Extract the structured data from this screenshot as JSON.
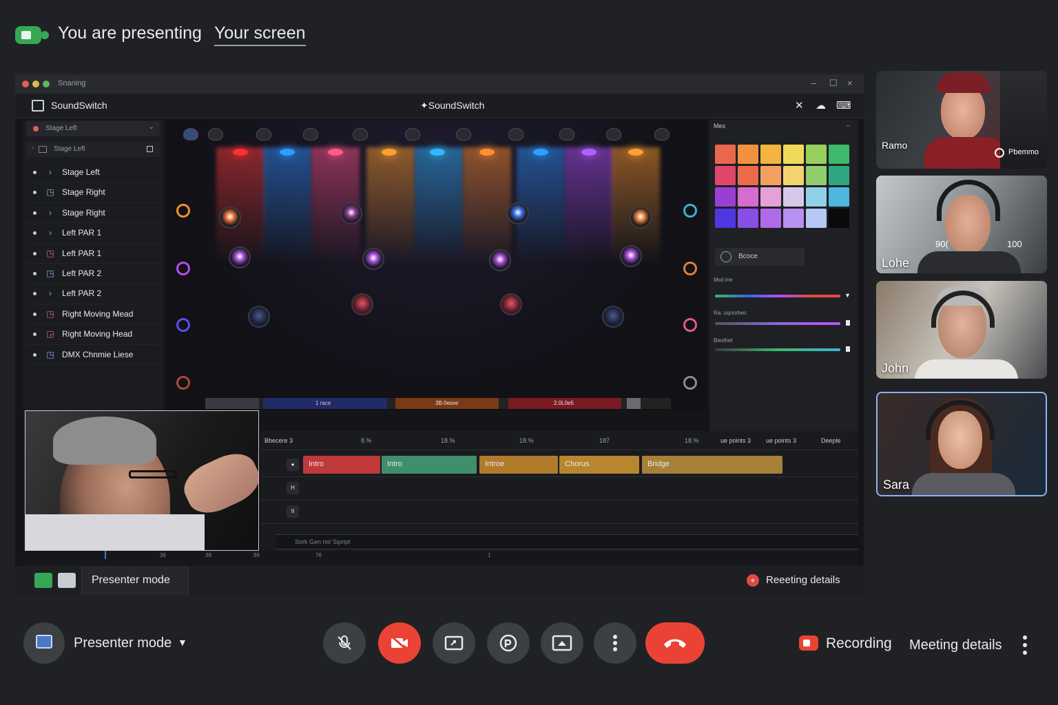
{
  "topbar": {
    "presenting_text": "You are presenting",
    "presenting_link": "Your screen"
  },
  "shared_window": {
    "title": "Snaning",
    "app_name": "SoundSwitch",
    "app_center_title": "✦SoundSwitch",
    "stage_select": "Stage Left",
    "group_label": "Stage Left",
    "fixtures": [
      {
        "label": "Stage Left",
        "icon": "chevron-right-icon"
      },
      {
        "label": "Stage Right",
        "icon": "fixture-box-icon"
      },
      {
        "label": "Stage Right",
        "icon": "chevron-right-icon"
      },
      {
        "label": "Left PAR 1",
        "icon": "chevron-right-icon"
      },
      {
        "label": "Left PAR 1",
        "icon": "fixture-box-icon"
      },
      {
        "label": "Left PAR 2",
        "icon": "fixture-box-icon"
      },
      {
        "label": "Left PAR 2",
        "icon": "chevron-right-icon"
      },
      {
        "label": "Right Moving Mead",
        "icon": "fixture-box-icon"
      },
      {
        "label": "Right Moving Head",
        "icon": "moving-head-icon"
      },
      {
        "label": "DMX Chnmie Liese",
        "icon": "fixture-box-icon"
      }
    ],
    "stage_bar": {
      "seg1": "1 race",
      "seg2": "3B.0esve",
      "seg3": "2.0L0e5"
    },
    "color_panel": {
      "title": "Mes",
      "swatches": [
        "#e8674d",
        "#f0923d",
        "#f4b440",
        "#efd95a",
        "#98cf5e",
        "#3fb86c",
        "#e0466a",
        "#ea6a4a",
        "#f4a060",
        "#f3d36e",
        "#8fcd6e",
        "#2fa882",
        "#9a3fd4",
        "#d66bd0",
        "#e6a0d8",
        "#d8c8e8",
        "#8fd0ea",
        "#4fb6e0",
        "#5038e0",
        "#8a4ee6",
        "#b06ae8",
        "#b890f0",
        "#b8c8f4",
        "#0a0a0a"
      ],
      "effect_label": "Bcoce",
      "slider1_label": "Mwt ine",
      "slider2_label": "Ra: oqnorbec",
      "slider3_label": "Beothet"
    },
    "timeline": {
      "title": "Bbecere 3",
      "ticks": [
        "8.%",
        "18.%",
        "18.%",
        "187",
        "18.%"
      ],
      "right_labels": [
        "ue points 3",
        "ue points 3",
        "Deeple"
      ],
      "segments": [
        {
          "label": "Intro",
          "color": "#c0393b"
        },
        {
          "label": "Intro",
          "color": "#3f8f6c"
        },
        {
          "label": "Introe",
          "color": "#b07a2a"
        },
        {
          "label": "Chorus",
          "color": "#b7862e"
        },
        {
          "label": "Bridge",
          "color": "#a68038"
        }
      ],
      "cue_track": "Sork Gen mi/ Sipript"
    },
    "ruler": [
      "36",
      "38",
      "86",
      "76",
      "1"
    ],
    "inner_footer": {
      "presenter_mode": "Presenter mode",
      "meeting_details": "Reeeting details"
    }
  },
  "participants": [
    {
      "name": "Ramo",
      "badge": "Pbemmo"
    },
    {
      "name": "Lohe",
      "overlay_left": "90(",
      "overlay_right": "100"
    },
    {
      "name": "John"
    },
    {
      "name": "Sara"
    }
  ],
  "controls": {
    "presenter_mode": "Presenter mode",
    "recording": "Recording",
    "meeting_details": "Meeting details"
  }
}
